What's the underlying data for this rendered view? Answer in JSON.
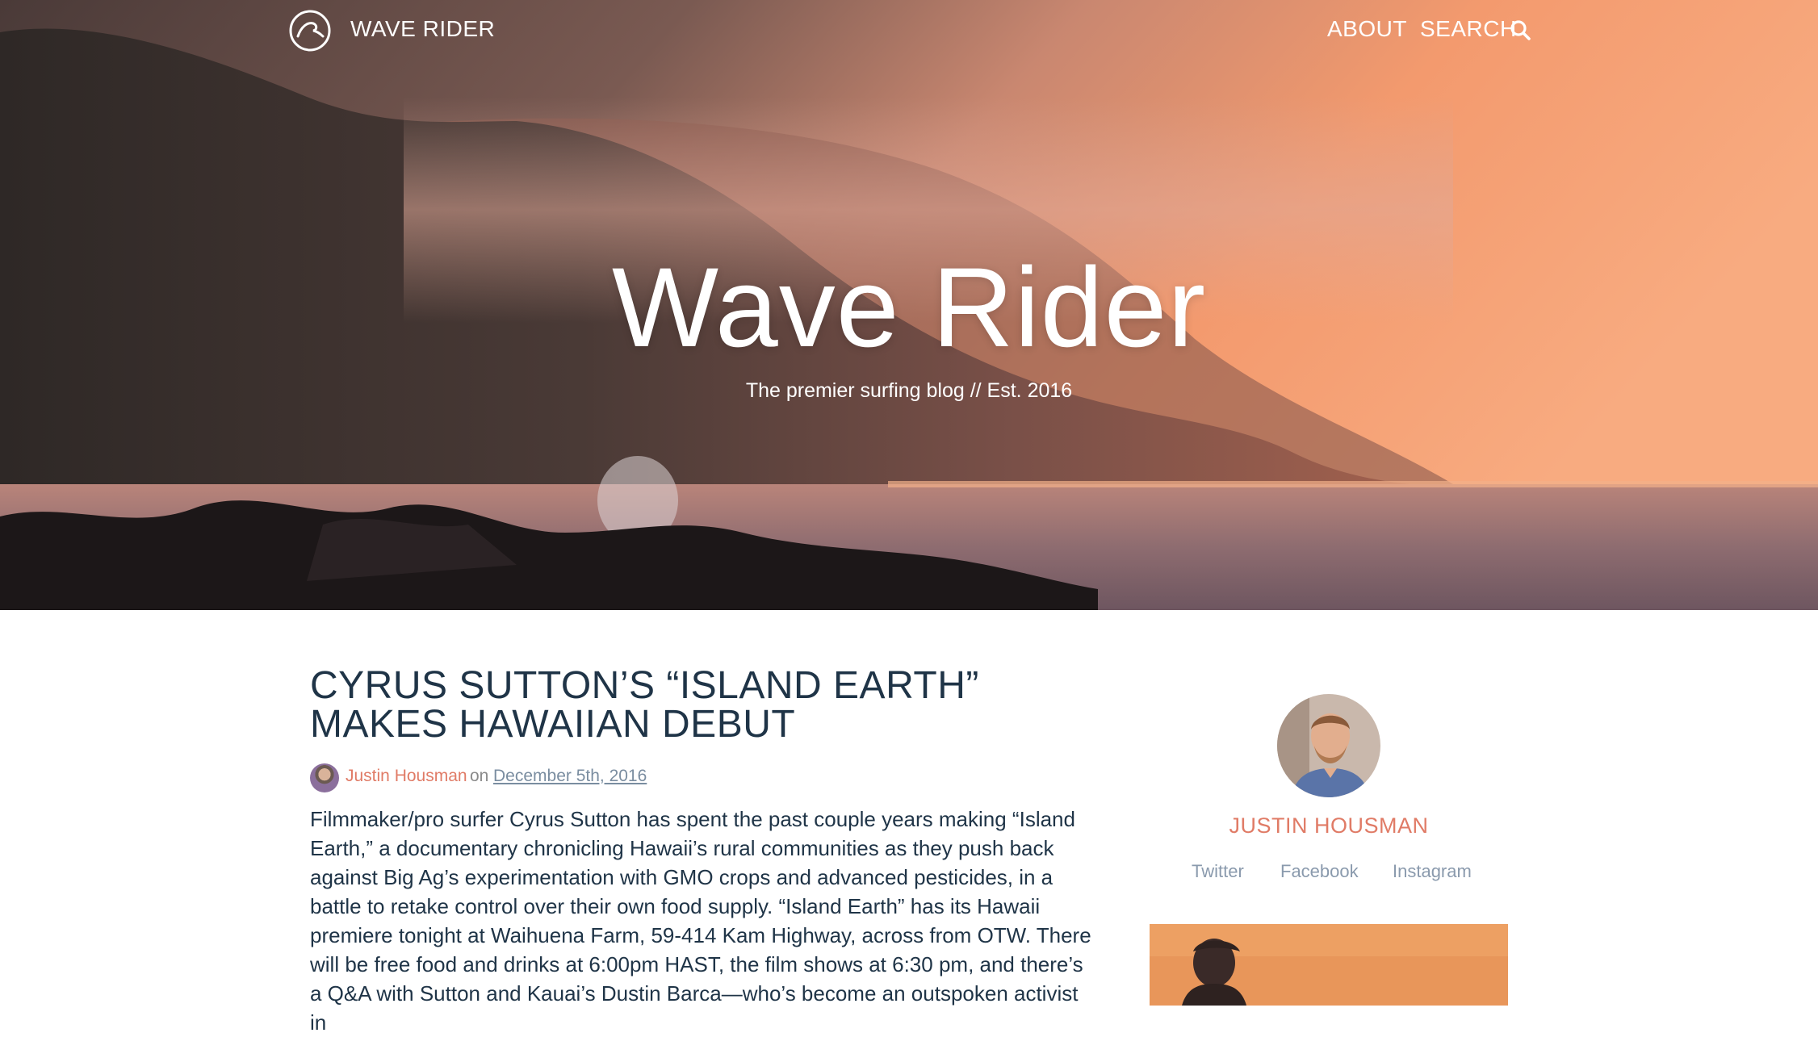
{
  "nav": {
    "brand": "WAVE RIDER",
    "about": "ABOUT",
    "search": "SEARCH",
    "logo_icon": "wave-logo-icon",
    "search_icon": "search-icon"
  },
  "hero": {
    "title": "Wave Rider",
    "tagline": "The premier surfing blog // Est. 2016"
  },
  "post": {
    "title": "CYRUS SUTTON’S “ISLAND EARTH” MAKES HAWAIIAN DEBUT",
    "author": "Justin Housman",
    "on": "on",
    "date": "December 5th, 2016",
    "body": "Filmmaker/pro surfer Cyrus Sutton has spent the past couple years making “Island Earth,” a documentary chronicling Hawaii’s rural communities as they push back against Big Ag’s experimentation with GMO crops and advanced pesticides, in a battle to retake control over their own food supply. “Island Earth” has its Hawaii premiere tonight at Waihuena Farm, 59-414 Kam Highway, across from OTW. There will be free food and drinks at 6:00pm HAST, the film shows at 6:30 pm, and there’s a Q&A with Sutton and Kauai’s Dustin Barca—who’s become an outspoken activist in"
  },
  "sidebar": {
    "author_name": "JUSTIN HOUSMAN",
    "links": {
      "twitter": "Twitter",
      "facebook": "Facebook",
      "instagram": "Instagram"
    }
  },
  "colors": {
    "accent": "#e07b66",
    "heading": "#1f3447",
    "muted_link": "#8a9aad"
  }
}
